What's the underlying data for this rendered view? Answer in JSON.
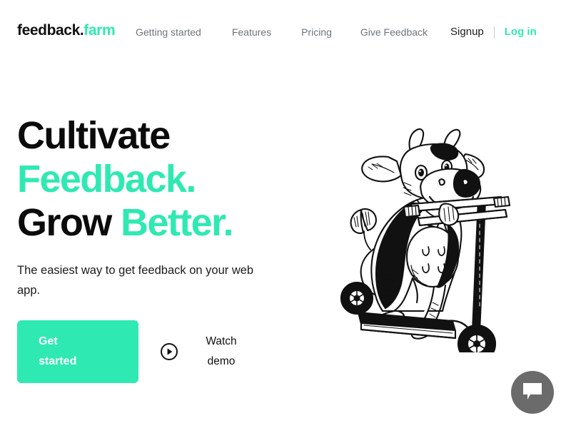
{
  "brand": {
    "logo_main": "feedback",
    "logo_dot": ".",
    "logo_tld": "farm",
    "accent_color": "#2FE9B2",
    "text_color": "#0b0b0b",
    "muted_color": "#6f7479"
  },
  "nav": {
    "links": [
      {
        "label": "Getting started"
      },
      {
        "label": "Features"
      },
      {
        "label": "Pricing"
      },
      {
        "label": "Give Feedback"
      }
    ],
    "signup_label": "Signup",
    "separator": "|",
    "login_label": "Log in"
  },
  "hero": {
    "headline_line1": "Cultivate",
    "headline_line2": "Feedback.",
    "headline_line3_black": "Grow ",
    "headline_line3_accent": "Better.",
    "subhead": "The easiest way to get feedback on your web app.",
    "primary_button_line1": "Get",
    "primary_button_line2": "started",
    "secondary_label_line1": "Watch",
    "secondary_label_line2": "demo",
    "play_icon": "play-circle-icon",
    "illustration_alt": "cow-riding-scooter-illustration"
  },
  "chat": {
    "icon": "chat-bubble-icon",
    "background_color": "#6b6b6b"
  }
}
